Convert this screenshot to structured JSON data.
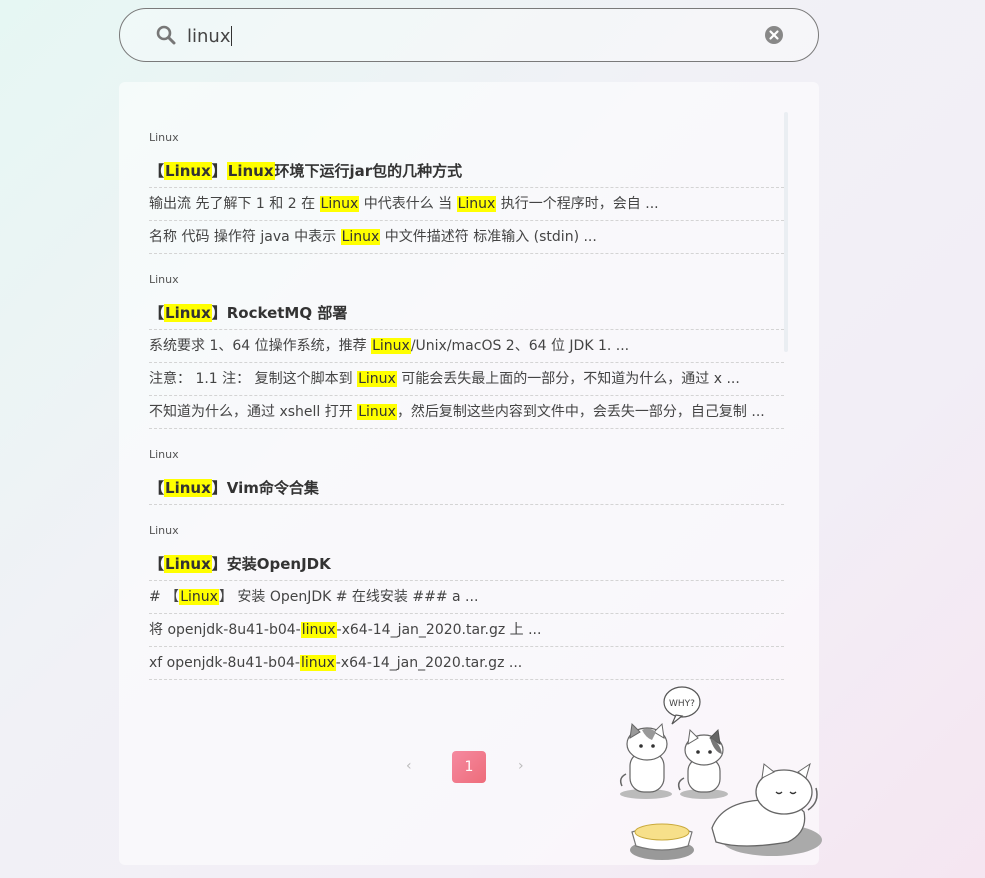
{
  "search": {
    "query": "linux",
    "icon": "search-icon",
    "clear_icon": "clear-icon"
  },
  "results": [
    {
      "category": "Linux",
      "title_parts": [
        "【",
        "Linux",
        "】",
        "Linux",
        "环境下运行jar包的几种方式"
      ],
      "snippets": [
        [
          "输出流 先了解下 1 和 2 在 ",
          "Linux",
          " 中代表什么 当 ",
          "Linux",
          " 执行一个程序时，会自 ..."
        ],
        [
          "名称 代码 操作符 java 中表示 ",
          "Linux",
          " 中文件描述符 标准输入 (stdin) ..."
        ]
      ]
    },
    {
      "category": "Linux",
      "title_parts": [
        "【",
        "Linux",
        "】RocketMQ 部署"
      ],
      "snippets": [
        [
          "系统要求 1、64 位操作系统，推荐 ",
          "Linux",
          "/Unix/macOS 2、64 位 JDK 1. ..."
        ],
        [
          "注意： 1.1 注： 复制这个脚本到 ",
          "Linux",
          " 可能会丢失最上面的一部分，不知道为什么，通过 x ..."
        ],
        [
          "不知道为什么，通过 xshell 打开 ",
          "Linux",
          "，然后复制这些内容到文件中，会丢失一部分，自己复制 ..."
        ]
      ]
    },
    {
      "category": "Linux",
      "title_parts": [
        "【",
        "Linux",
        "】Vim命令合集"
      ],
      "snippets": []
    },
    {
      "category": "Linux",
      "title_parts": [
        "【",
        "Linux",
        "】安装OpenJDK"
      ],
      "snippets": [
        [
          "# 【",
          "Linux",
          "】 安装 OpenJDK # 在线安装 ### a ..."
        ],
        [
          "将 openjdk-8u41-b04-",
          "linux",
          "-x64-14_jan_2020.tar.gz 上 ..."
        ],
        [
          "xf openjdk-8u41-b04-",
          "linux",
          "-x64-14_jan_2020.tar.gz ..."
        ]
      ]
    }
  ],
  "pagination": {
    "prev": "‹",
    "current": "1",
    "next": "›"
  },
  "decoration": {
    "speech_text": "WHY?",
    "illustration": "cats-illustration"
  },
  "colors": {
    "highlight": "#ffff00",
    "page_active": "#ee6c7a"
  }
}
